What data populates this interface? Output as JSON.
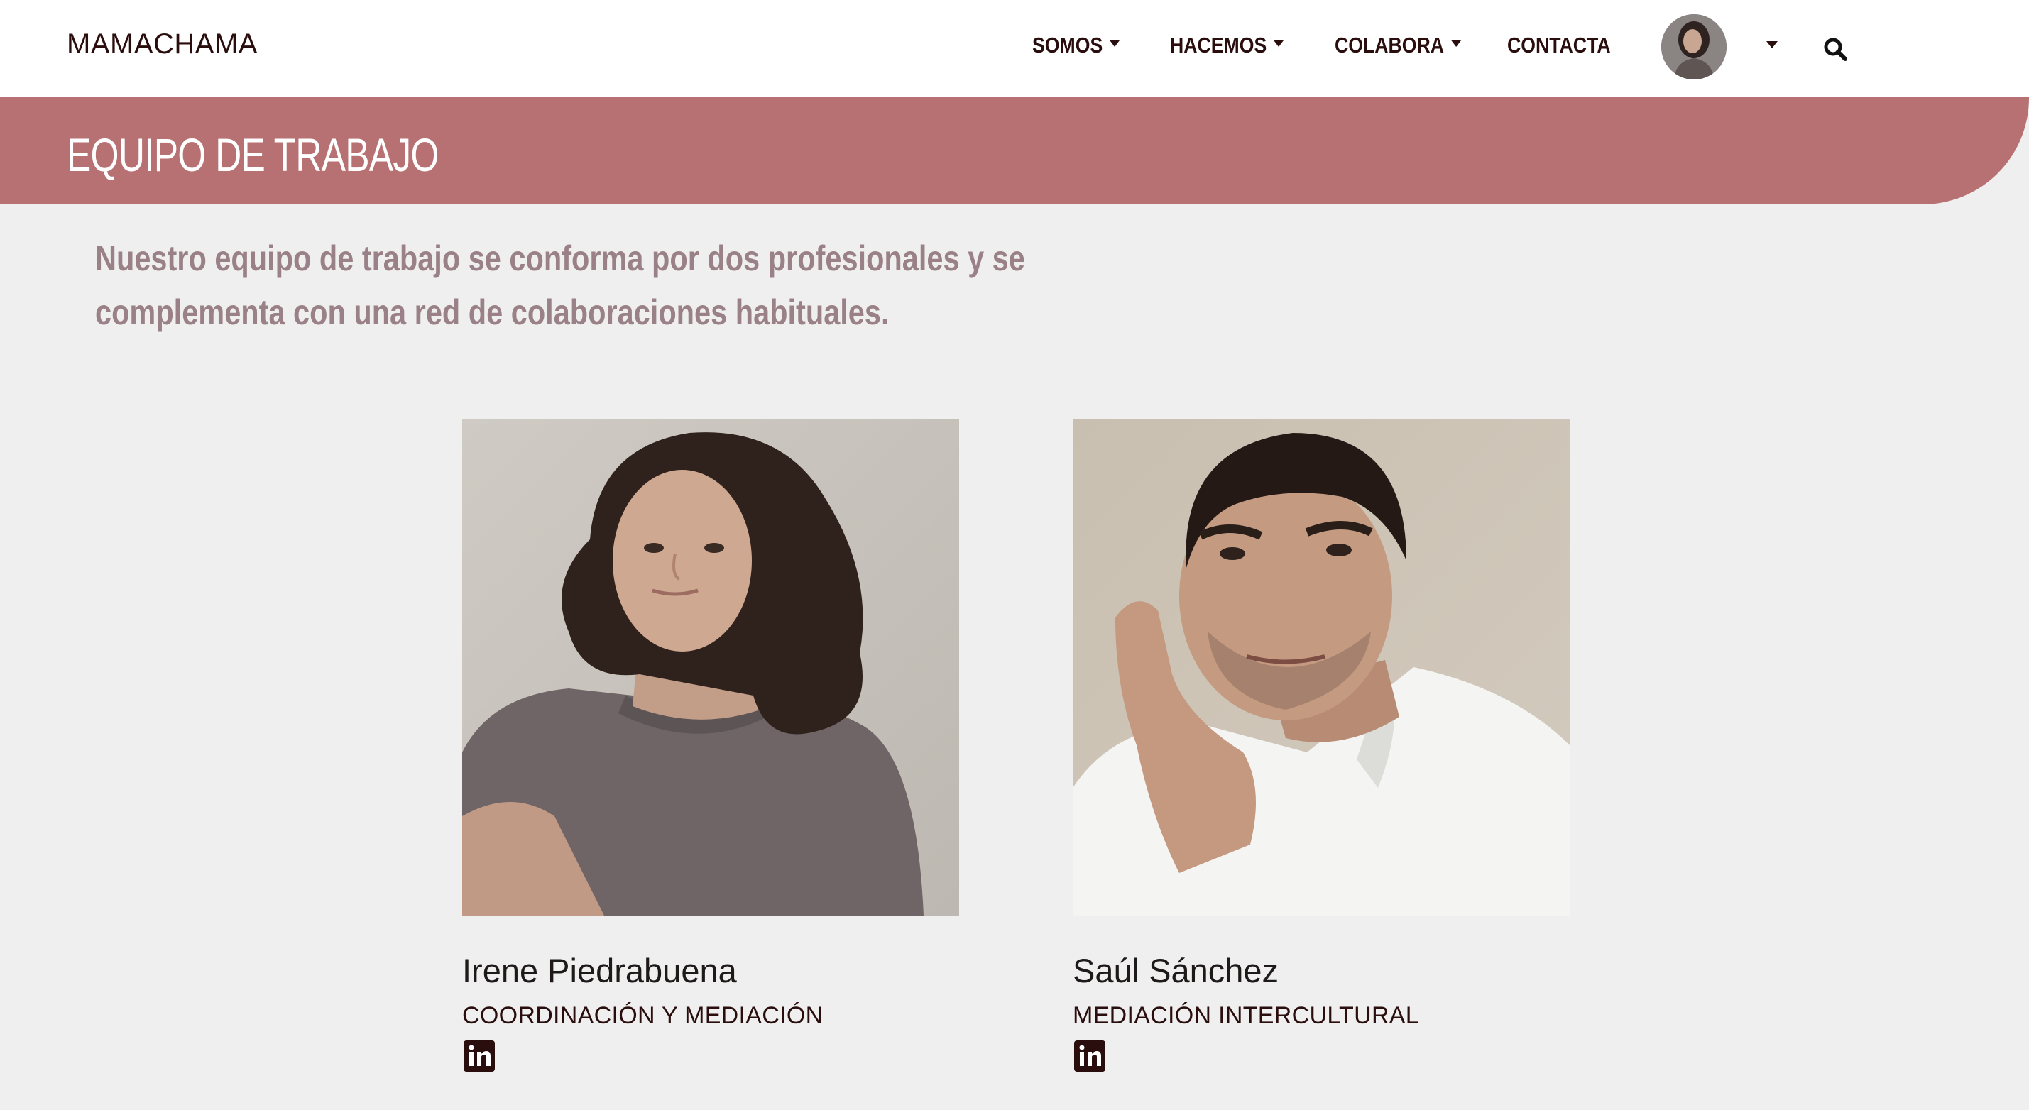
{
  "navbar": {
    "brand": "MAMACHAMA",
    "items": [
      {
        "label": "SOMOS",
        "dropdown": true
      },
      {
        "label": "HACEMOS",
        "dropdown": true
      },
      {
        "label": "COLABORA",
        "dropdown": true
      },
      {
        "label": "CONTACTA",
        "dropdown": false
      }
    ],
    "search_icon": "search-icon"
  },
  "banner": {
    "title": "EQUIPO DE TRABAJO"
  },
  "intro": {
    "text": "Nuestro equipo de trabajo se conforma por dos profesionales y se complementa con una red de colaboraciones habituales."
  },
  "team": [
    {
      "name": "Irene Piedrabuena",
      "role": "COORDINACIÓN Y MEDIACIÓN",
      "icon": "linkedin-icon"
    },
    {
      "name": "Saúl Sánchez",
      "role": "MEDIACIÓN INTERCULTURAL",
      "icon": "linkedin-icon"
    }
  ],
  "colors": {
    "banner": "#b87173",
    "intro_text": "#9a8187",
    "dark_brown": "#2a0e0e",
    "background": "#efefef"
  }
}
